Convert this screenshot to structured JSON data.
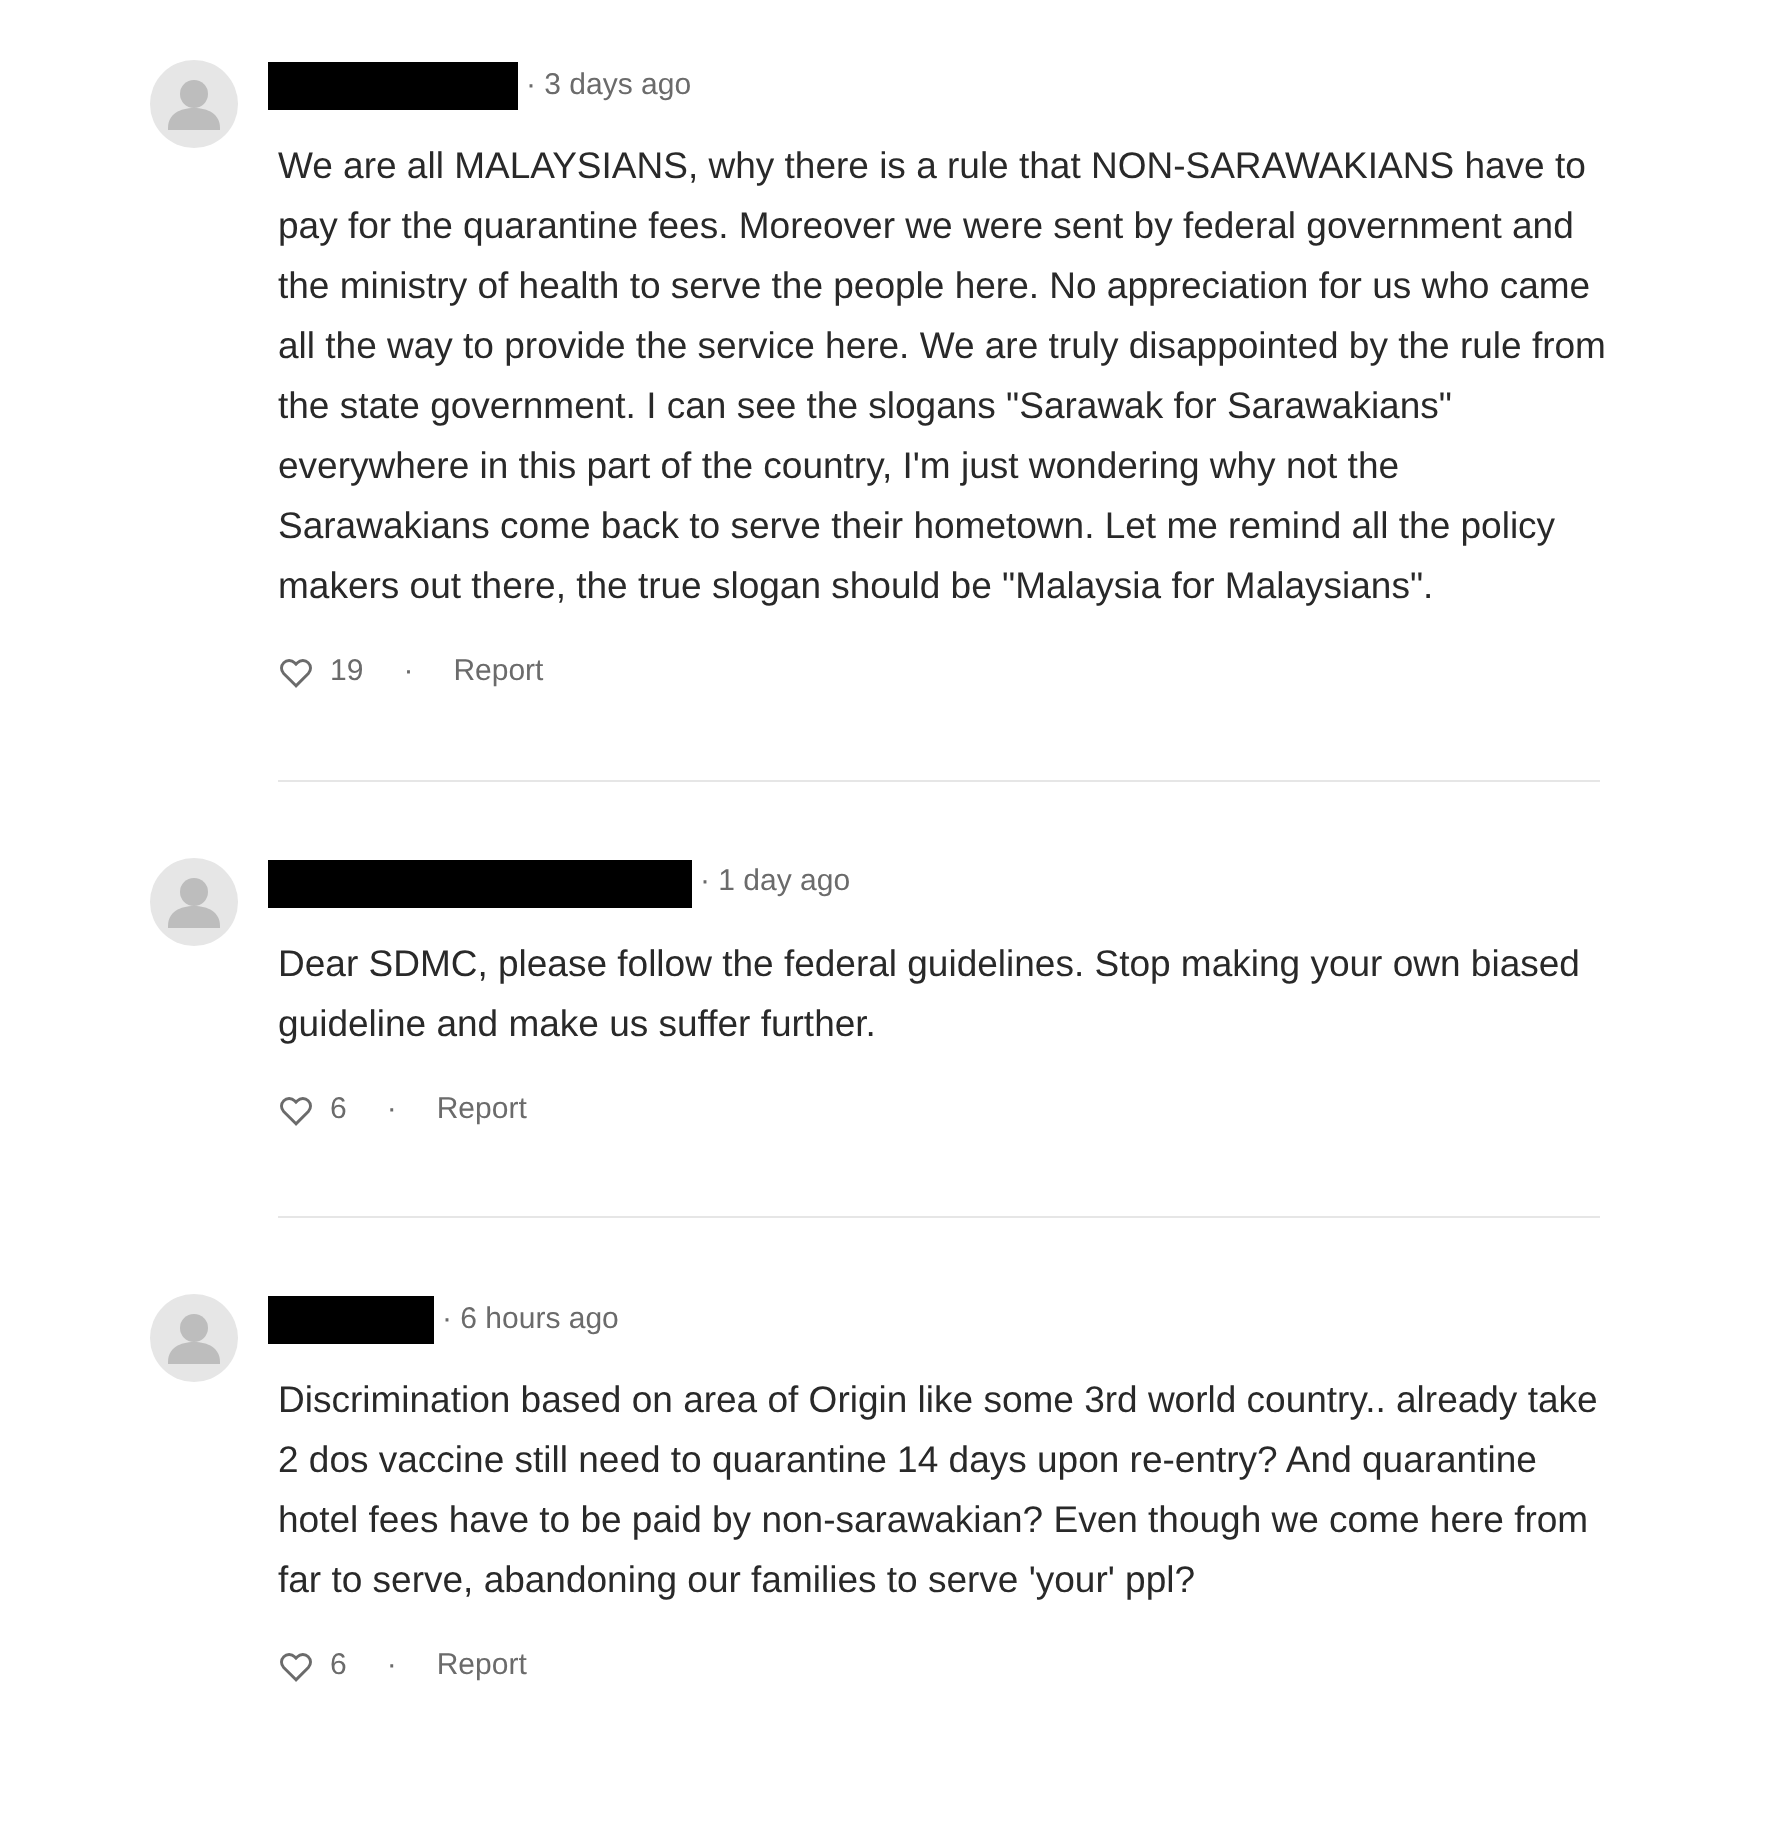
{
  "comments": [
    {
      "time": "· 3 days ago",
      "body": "We are all MALAYSIANS, why there is a rule that NON-SARAWAKIANS have to pay for the quarantine fees. Moreover we were sent by federal government and the ministry of health to serve the people here. No appreciation for us who came all the way to provide the service here. We are truly disappointed by the rule from the state government. I can see the slogans \"Sarawak for Sarawakians\" everywhere in this part of the country, I'm just wondering why not the Sarawakians come back to serve their hometown. Let me remind all the policy makers out there, the true slogan should be \"Malaysia for Malaysians\".",
      "likes": "19",
      "separator": "·",
      "report": "Report"
    },
    {
      "time": "· 1 day ago",
      "body": "Dear SDMC, please follow the federal guidelines. Stop making your own biased guideline and make us suffer further.",
      "likes": "6",
      "separator": "·",
      "report": "Report"
    },
    {
      "time": "· 6 hours ago",
      "body": "Discrimination based on area of Origin like some 3rd world country.. already take 2 dos vaccine still need to quarantine 14 days upon re-entry? And quarantine hotel fees have to be paid by non-sarawakian? Even though we come here from far to serve, abandoning our families to serve 'your' ppl?",
      "likes": "6",
      "separator": "·",
      "report": "Report"
    }
  ]
}
